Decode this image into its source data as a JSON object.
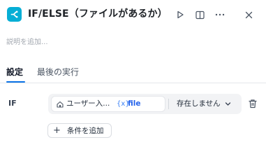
{
  "header": {
    "title": "IF/ELSE（ファイルがあるか）",
    "node_icon": "branch-icon",
    "actions": [
      "run-icon",
      "panel-toggle-icon",
      "more-icon",
      "close-icon"
    ]
  },
  "description": {
    "placeholder": "説明を追加..."
  },
  "tabs": [
    {
      "label": "設定",
      "active": true
    },
    {
      "label": "最後の実行",
      "active": false
    }
  ],
  "condition": {
    "branch_label": "IF",
    "variable": {
      "source_icon": "home-icon",
      "source": "ユーザー入...",
      "var_icon": "{x}",
      "name": "file"
    },
    "operator": "存在しません",
    "delete_icon": "trash-icon"
  },
  "add_condition": {
    "icon": "+",
    "label": "条件を追加"
  },
  "colors": {
    "accent": "#0b73e6",
    "node_icon_bg": "#06aed5",
    "variable_text": "#2563eb"
  }
}
